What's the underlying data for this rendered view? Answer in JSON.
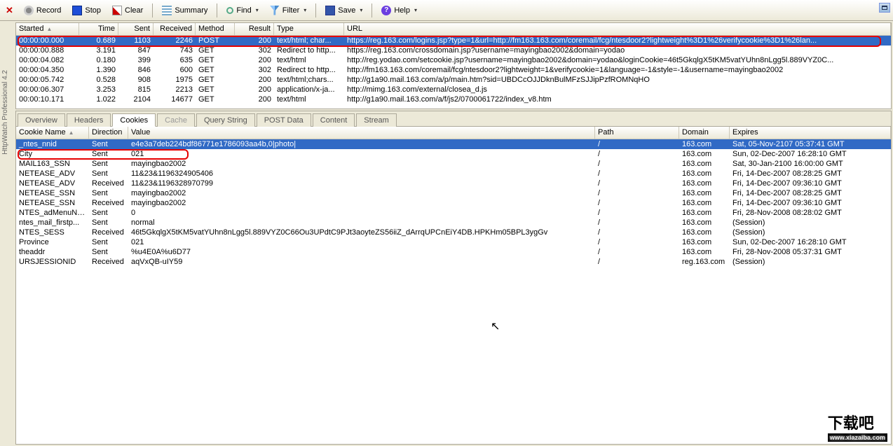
{
  "app_name": "HttpWatch Professional 4.2",
  "toolbar": {
    "record": "Record",
    "stop": "Stop",
    "clear": "Clear",
    "summary": "Summary",
    "find": "Find",
    "filter": "Filter",
    "save": "Save",
    "help": "Help"
  },
  "top_grid": {
    "headers": {
      "started": "Started",
      "time": "Time",
      "sent": "Sent",
      "received": "Received",
      "method": "Method",
      "result": "Result",
      "type": "Type",
      "url": "URL"
    },
    "rows": [
      {
        "started": "00:00:00.000",
        "time": "0.689",
        "sent": "1103",
        "recv": "2246",
        "method": "POST",
        "result": "200",
        "type": "text/html; char...",
        "url": "https://reg.163.com/logins.jsp?type=1&url=http://fm163.163.com/coremail/fcg/ntesdoor2?lightweight%3D1%26verifycookie%3D1%26lan...",
        "sel": true
      },
      {
        "started": "00:00:00.888",
        "time": "3.191",
        "sent": "847",
        "recv": "743",
        "method": "GET",
        "result": "302",
        "type": "Redirect to http...",
        "url": "https://reg.163.com/crossdomain.jsp?username=mayingbao2002&domain=yodao"
      },
      {
        "started": "00:00:04.082",
        "time": "0.180",
        "sent": "399",
        "recv": "635",
        "method": "GET",
        "result": "200",
        "type": "text/html",
        "url": "http://reg.yodao.com/setcookie.jsp?username=mayingbao2002&domain=yodao&loginCookie=46t5GkqlgX5tKM5vatYUhn8nLgg5l.889VYZ0C..."
      },
      {
        "started": "00:00:04.350",
        "time": "1.390",
        "sent": "846",
        "recv": "600",
        "method": "GET",
        "result": "302",
        "type": "Redirect to http...",
        "url": "http://fm163.163.com/coremail/fcg/ntesdoor2?lightweight=1&verifycookie=1&language=-1&style=-1&username=mayingbao2002"
      },
      {
        "started": "00:00:05.742",
        "time": "0.528",
        "sent": "908",
        "recv": "1975",
        "method": "GET",
        "result": "200",
        "type": "text/html;chars...",
        "url": "http://g1a90.mail.163.com/a/p/main.htm?sid=UBDCcOJJDknBulMFzSJJipPzfROMNqHO"
      },
      {
        "started": "00:00:06.307",
        "time": "3.253",
        "sent": "815",
        "recv": "2213",
        "method": "GET",
        "result": "200",
        "type": "application/x-ja...",
        "url": "http://mimg.163.com/external/closea_d.js"
      },
      {
        "started": "00:00:10.171",
        "time": "1.022",
        "sent": "2104",
        "recv": "14677",
        "method": "GET",
        "result": "200",
        "type": "text/html",
        "url": "http://g1a90.mail.163.com/a/f/js2/0700061722/index_v8.htm"
      }
    ]
  },
  "tabs": [
    {
      "label": "Overview",
      "active": false
    },
    {
      "label": "Headers",
      "active": false
    },
    {
      "label": "Cookies",
      "active": true
    },
    {
      "label": "Cache",
      "active": false,
      "disabled": true
    },
    {
      "label": "Query String",
      "active": false
    },
    {
      "label": "POST Data",
      "active": false
    },
    {
      "label": "Content",
      "active": false
    },
    {
      "label": "Stream",
      "active": false
    }
  ],
  "cookies_grid": {
    "headers": {
      "name": "Cookie Name",
      "dir": "Direction",
      "val": "Value",
      "path": "Path",
      "dom": "Domain",
      "exp": "Expires"
    },
    "rows": [
      {
        "name": "_ntes_nnid",
        "dir": "Sent",
        "val": "e4e3a7deb224bdf86771e1786093aa4b,0|photo|",
        "path": "/",
        "dom": "163.com",
        "exp": "Sat, 05-Nov-2107 05:37:41 GMT",
        "sel": true
      },
      {
        "name": "City",
        "dir": "Sent",
        "val": "021",
        "path": "/",
        "dom": "163.com",
        "exp": "Sun, 02-Dec-2007 16:28:10 GMT",
        "red": true
      },
      {
        "name": "MAIL163_SSN",
        "dir": "Sent",
        "val": "mayingbao2002",
        "path": "/",
        "dom": "163.com",
        "exp": "Sat, 30-Jan-2100 16:00:00 GMT"
      },
      {
        "name": "NETEASE_ADV",
        "dir": "Sent",
        "val": "11&23&1196324905406",
        "path": "/",
        "dom": "163.com",
        "exp": "Fri, 14-Dec-2007 08:28:25 GMT"
      },
      {
        "name": "NETEASE_ADV",
        "dir": "Received",
        "val": "11&23&1196328970799",
        "path": "/",
        "dom": "163.com",
        "exp": "Fri, 14-Dec-2007 09:36:10 GMT"
      },
      {
        "name": "NETEASE_SSN",
        "dir": "Sent",
        "val": "mayingbao2002",
        "path": "/",
        "dom": "163.com",
        "exp": "Fri, 14-Dec-2007 08:28:25 GMT"
      },
      {
        "name": "NETEASE_SSN",
        "dir": "Received",
        "val": "mayingbao2002",
        "path": "/",
        "dom": "163.com",
        "exp": "Fri, 14-Dec-2007 09:36:10 GMT"
      },
      {
        "name": "NTES_adMenuNum",
        "dir": "Sent",
        "val": "0",
        "path": "/",
        "dom": "163.com",
        "exp": "Fri, 28-Nov-2008 08:28:02 GMT"
      },
      {
        "name": "ntes_mail_firstp...",
        "dir": "Sent",
        "val": "normal",
        "path": "/",
        "dom": "163.com",
        "exp": "(Session)"
      },
      {
        "name": "NTES_SESS",
        "dir": "Received",
        "val": "46t5GkqlgX5tKM5vatYUhn8nLgg5l.889VYZ0C66Ou3UPdtC9PJt3aoyteZS56iiZ_dArrqUPCnEiY4DB.HPKHm05BPL3ygGv",
        "path": "/",
        "dom": "163.com",
        "exp": "(Session)"
      },
      {
        "name": "Province",
        "dir": "Sent",
        "val": "021",
        "path": "/",
        "dom": "163.com",
        "exp": "Sun, 02-Dec-2007 16:28:10 GMT"
      },
      {
        "name": "theaddr",
        "dir": "Sent",
        "val": "%u4E0A%u6D77",
        "path": "/",
        "dom": "163.com",
        "exp": "Fri, 28-Nov-2008 05:37:31 GMT"
      },
      {
        "name": "URSJESSIONID",
        "dir": "Received",
        "val": "aqVxQB-uIY59",
        "path": "/",
        "dom": "reg.163.com",
        "exp": "(Session)"
      }
    ]
  },
  "watermark": {
    "big": "下载吧",
    "small": "www.xiazaiba.com"
  }
}
